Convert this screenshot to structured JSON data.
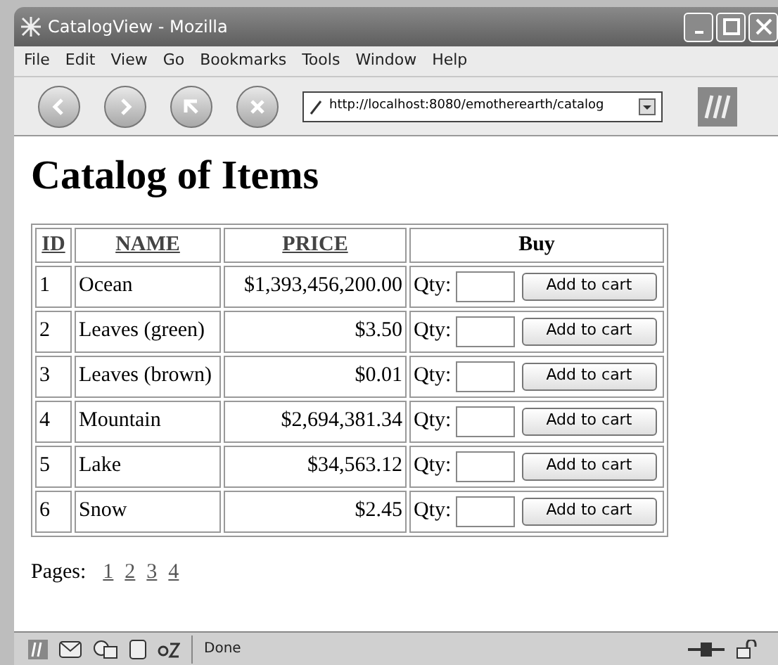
{
  "window": {
    "title": "CatalogView - Mozilla"
  },
  "menu": [
    "File",
    "Edit",
    "View",
    "Go",
    "Bookmarks",
    "Tools",
    "Window",
    "Help"
  ],
  "address": {
    "value": "http://localhost:8080/emotherearth/catalog"
  },
  "heading": "Catalog of Items",
  "table": {
    "columns": [
      "ID",
      "NAME",
      "PRICE",
      "Buy"
    ],
    "rows": [
      {
        "id": "1",
        "name": "Ocean",
        "price": "$1,393,456,200.00",
        "qty_label": "Qty:",
        "button": "Add to cart"
      },
      {
        "id": "2",
        "name": "Leaves (green)",
        "price": "$3.50",
        "qty_label": "Qty:",
        "button": "Add to cart"
      },
      {
        "id": "3",
        "name": "Leaves (brown)",
        "price": "$0.01",
        "qty_label": "Qty:",
        "button": "Add to cart"
      },
      {
        "id": "4",
        "name": "Mountain",
        "price": "$2,694,381.34",
        "qty_label": "Qty:",
        "button": "Add to cart"
      },
      {
        "id": "5",
        "name": "Lake",
        "price": "$34,563.12",
        "qty_label": "Qty:",
        "button": "Add to cart"
      },
      {
        "id": "6",
        "name": "Snow",
        "price": "$2.45",
        "qty_label": "Qty:",
        "button": "Add to cart"
      }
    ]
  },
  "pages": {
    "label": "Pages:",
    "links": [
      "1",
      "2",
      "3",
      "4"
    ]
  },
  "status_bar": {
    "text": "Done"
  }
}
